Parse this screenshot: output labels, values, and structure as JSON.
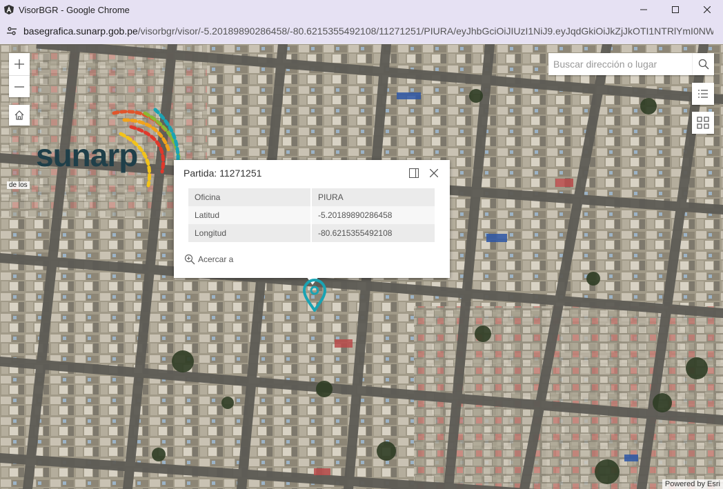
{
  "window": {
    "title": "VisorBGR - Google Chrome"
  },
  "address_bar": {
    "host": "basegrafica.sunarp.gob.pe",
    "path": "/visorbgr/visor/-5.20189890286458/-80.6215355492108/11271251/PIURA/eyJhbGciOiJIUzI1NiJ9.eyJqdGkiOiJkZjJkOTI1NTRlYmI0NWY..."
  },
  "map": {
    "logo_text": "sunarp",
    "map_label": "de los",
    "search": {
      "placeholder": "Buscar dirección o lugar"
    },
    "attribution": "Powered by Esri"
  },
  "popup": {
    "title": "Partida: 11271251",
    "rows": [
      {
        "label": "Oficina",
        "value": "PIURA"
      },
      {
        "label": "Latitud",
        "value": "-5.20189890286458"
      },
      {
        "label": "Longitud",
        "value": "-80.6215355492108"
      }
    ],
    "zoom_link": "Acercar a"
  },
  "colors": {
    "marker": "#1aa3b3",
    "logo_text": "#1f3f49",
    "chrome_frame": "#e6e1f3"
  }
}
